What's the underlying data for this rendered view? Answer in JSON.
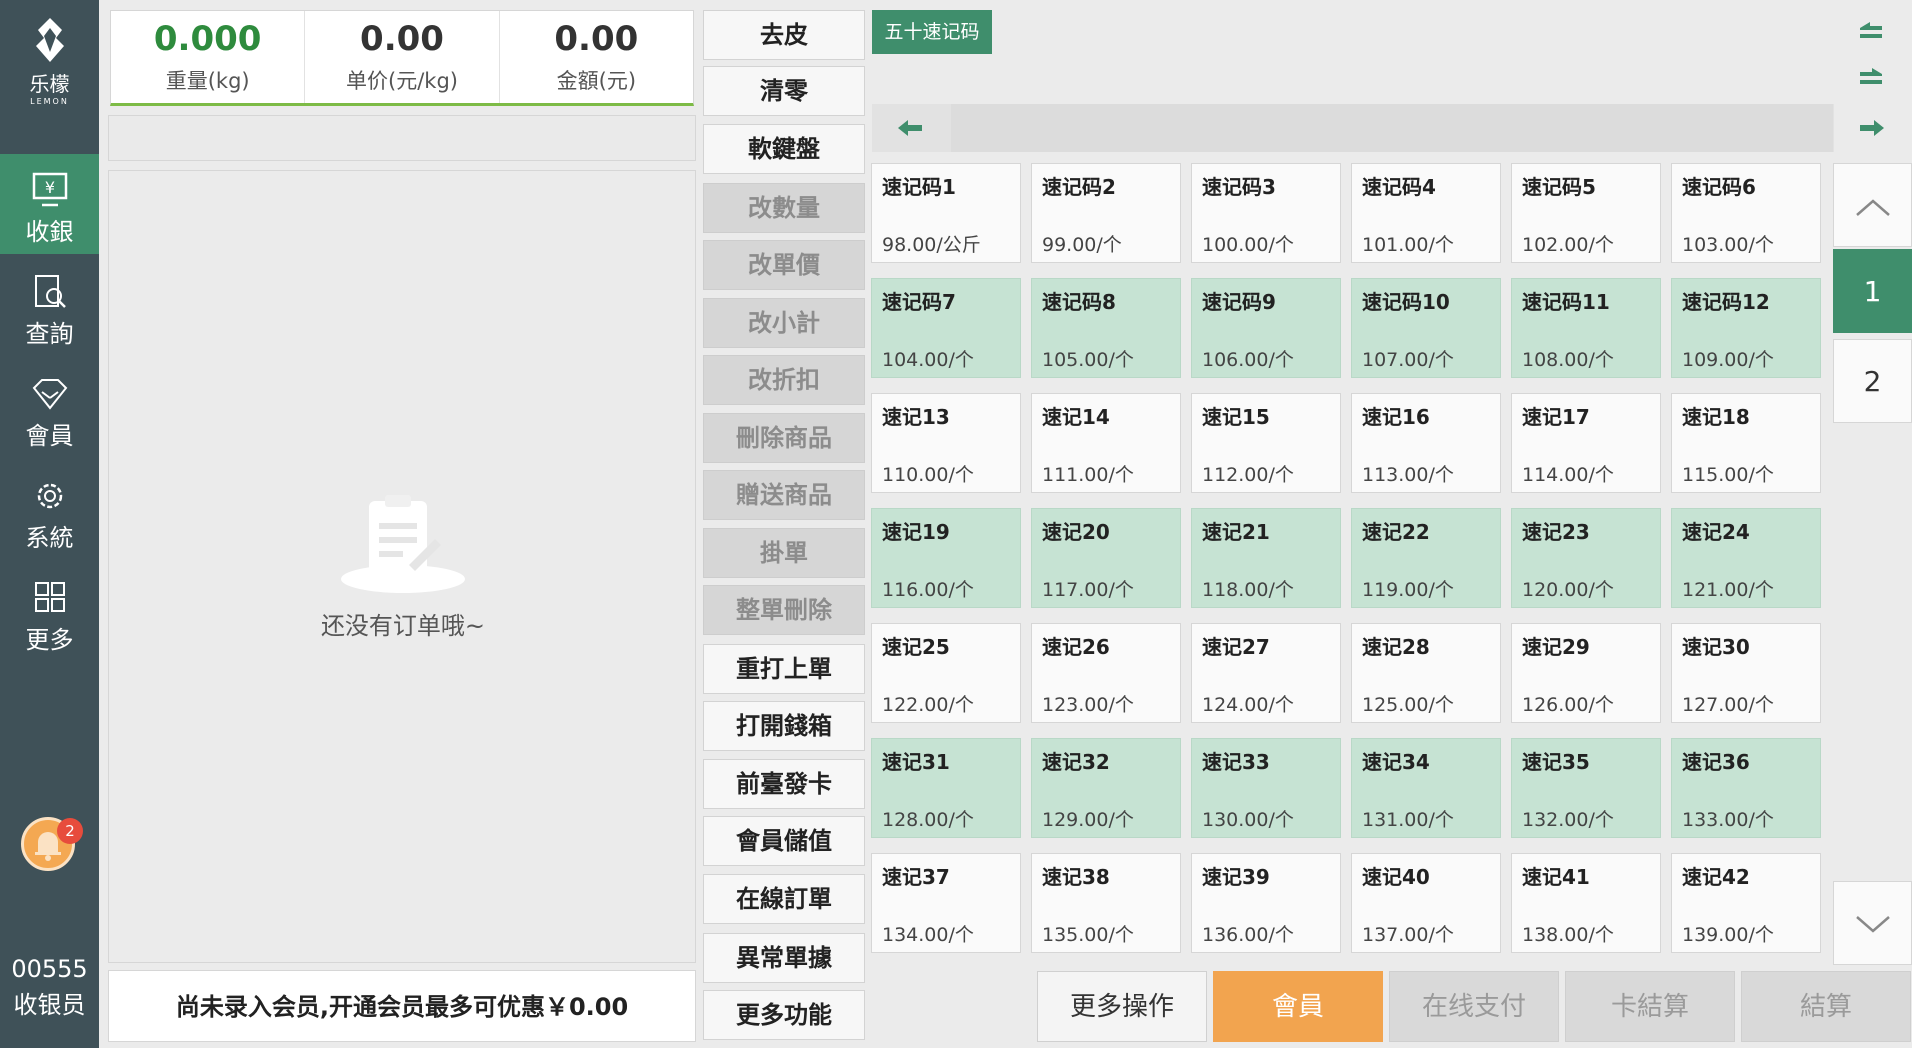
{
  "sidebar": {
    "logo_text": "乐檬",
    "logo_sub": "LEMON",
    "items": [
      {
        "label": "收銀",
        "icon": "cashier-icon"
      },
      {
        "label": "查詢",
        "icon": "search-doc-icon"
      },
      {
        "label": "會員",
        "icon": "member-diamond-icon"
      },
      {
        "label": "系統",
        "icon": "gear-icon"
      },
      {
        "label": "更多",
        "icon": "grid-icon"
      }
    ],
    "notification_count": "2",
    "cashier_id": "00555",
    "cashier_role": "收银员"
  },
  "scale": {
    "weight_value": "0.000",
    "weight_label": "重量(kg)",
    "unit_price_value": "0.00",
    "unit_price_label": "单价(元/kg)",
    "amount_value": "0.00",
    "amount_label": "金額(元)"
  },
  "order": {
    "empty_text": "还没有订单哦~"
  },
  "member_bar": {
    "text": "尚未录入会员,开通会员最多可优惠￥0.00"
  },
  "functions": [
    {
      "label": "去皮",
      "disabled": false
    },
    {
      "label": "清零",
      "disabled": false
    },
    {
      "label": "軟鍵盤",
      "disabled": false
    },
    {
      "label": "改數量",
      "disabled": true
    },
    {
      "label": "改單價",
      "disabled": true
    },
    {
      "label": "改小計",
      "disabled": true
    },
    {
      "label": "改折扣",
      "disabled": true
    },
    {
      "label": "刪除商品",
      "disabled": true
    },
    {
      "label": "贈送商品",
      "disabled": true
    },
    {
      "label": "掛單",
      "disabled": true
    },
    {
      "label": "整單刪除",
      "disabled": true
    },
    {
      "label": "重打上單",
      "disabled": false
    },
    {
      "label": "打開錢箱",
      "disabled": false
    },
    {
      "label": "前臺發卡",
      "disabled": false
    },
    {
      "label": "會員儲值",
      "disabled": false
    },
    {
      "label": "在線訂單",
      "disabled": false
    },
    {
      "label": "異常單據",
      "disabled": false
    },
    {
      "label": "更多功能",
      "disabled": false
    }
  ],
  "category": {
    "active_tab": "五十速记码"
  },
  "products": [
    {
      "name": "速记码1",
      "price": "98.00/公斤"
    },
    {
      "name": "速记码2",
      "price": "99.00/个"
    },
    {
      "name": "速记码3",
      "price": "100.00/个"
    },
    {
      "name": "速记码4",
      "price": "101.00/个"
    },
    {
      "name": "速记码5",
      "price": "102.00/个"
    },
    {
      "name": "速记码6",
      "price": "103.00/个"
    },
    {
      "name": "速记码7",
      "price": "104.00/个"
    },
    {
      "name": "速记码8",
      "price": "105.00/个"
    },
    {
      "name": "速记码9",
      "price": "106.00/个"
    },
    {
      "name": "速记码10",
      "price": "107.00/个"
    },
    {
      "name": "速记码11",
      "price": "108.00/个"
    },
    {
      "name": "速记码12",
      "price": "109.00/个"
    },
    {
      "name": "速记13",
      "price": "110.00/个"
    },
    {
      "name": "速记14",
      "price": "111.00/个"
    },
    {
      "name": "速记15",
      "price": "112.00/个"
    },
    {
      "name": "速记16",
      "price": "113.00/个"
    },
    {
      "name": "速记17",
      "price": "114.00/个"
    },
    {
      "name": "速记18",
      "price": "115.00/个"
    },
    {
      "name": "速记19",
      "price": "116.00/个"
    },
    {
      "name": "速记20",
      "price": "117.00/个"
    },
    {
      "name": "速记21",
      "price": "118.00/个"
    },
    {
      "name": "速记22",
      "price": "119.00/个"
    },
    {
      "name": "速记23",
      "price": "120.00/个"
    },
    {
      "name": "速记24",
      "price": "121.00/个"
    },
    {
      "name": "速记25",
      "price": "122.00/个"
    },
    {
      "name": "速记26",
      "price": "123.00/个"
    },
    {
      "name": "速记27",
      "price": "124.00/个"
    },
    {
      "name": "速记28",
      "price": "125.00/个"
    },
    {
      "name": "速记29",
      "price": "126.00/个"
    },
    {
      "name": "速记30",
      "price": "127.00/个"
    },
    {
      "name": "速记31",
      "price": "128.00/个"
    },
    {
      "name": "速记32",
      "price": "129.00/个"
    },
    {
      "name": "速记33",
      "price": "130.00/个"
    },
    {
      "name": "速记34",
      "price": "131.00/个"
    },
    {
      "name": "速记35",
      "price": "132.00/个"
    },
    {
      "name": "速记36",
      "price": "133.00/个"
    },
    {
      "name": "速记37",
      "price": "134.00/个"
    },
    {
      "name": "速记38",
      "price": "135.00/个"
    },
    {
      "name": "速记39",
      "price": "136.00/个"
    },
    {
      "name": "速记40",
      "price": "137.00/个"
    },
    {
      "name": "速记41",
      "price": "138.00/个"
    },
    {
      "name": "速记42",
      "price": "139.00/个"
    }
  ],
  "pagination": {
    "pages": [
      "1",
      "2"
    ],
    "current": "1"
  },
  "actions": [
    {
      "label": "更多操作",
      "style": "plain"
    },
    {
      "label": "會員",
      "style": "orange"
    },
    {
      "label": "在线支付",
      "style": "disabled"
    },
    {
      "label": "卡結算",
      "style": "disabled"
    },
    {
      "label": "結算",
      "style": "disabled"
    }
  ],
  "colors": {
    "sidebar_bg": "#3f5158",
    "accent_green": "#3f8e6c",
    "product_green": "#c6e3d3",
    "member_orange": "#f2a44f"
  }
}
